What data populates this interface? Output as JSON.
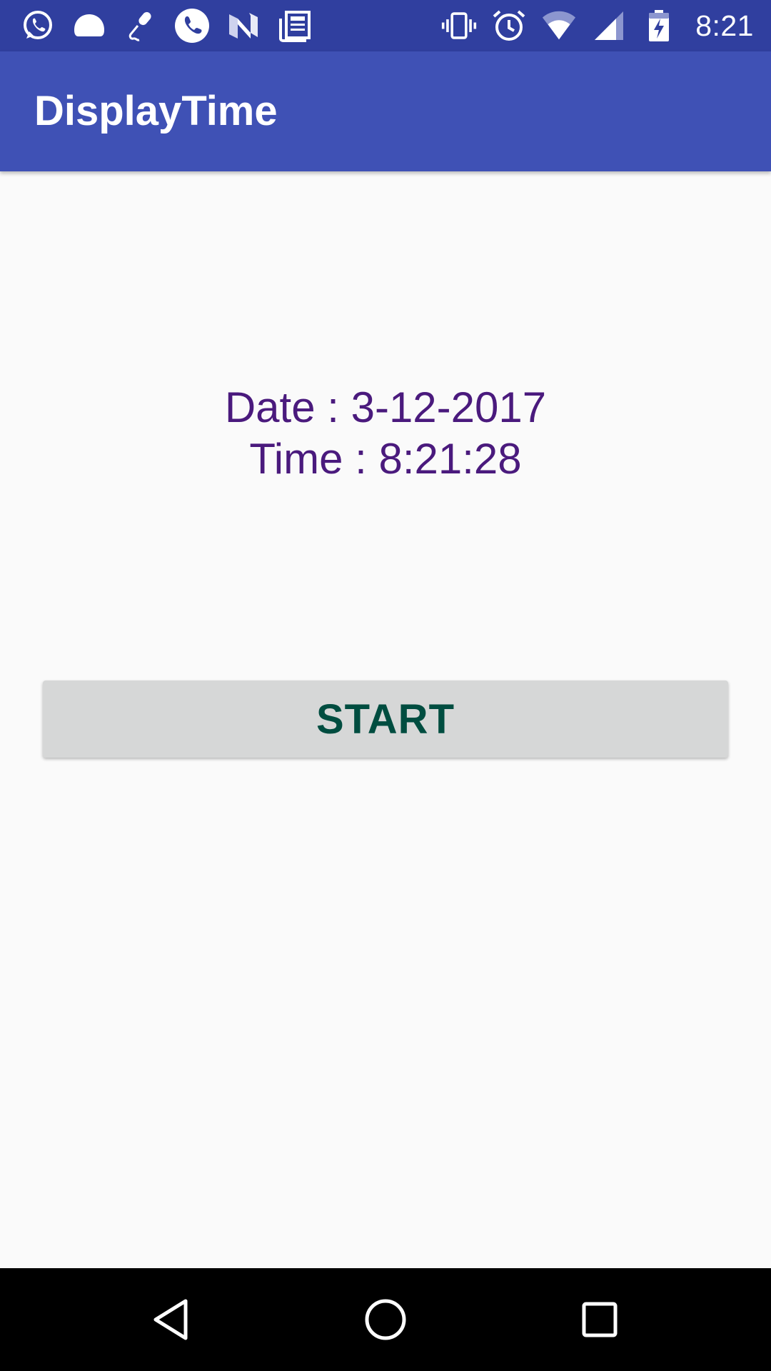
{
  "status_bar": {
    "time": "8:21",
    "left_icons": [
      "whatsapp-icon",
      "chat-bubble-icon",
      "microphone-icon",
      "phone-icon",
      "n-logo-icon",
      "news-icon"
    ],
    "right_icons": [
      "vibrate-icon",
      "alarm-icon",
      "wifi-icon",
      "cell-signal-icon",
      "battery-charging-icon"
    ],
    "background_color": "#303f9f"
  },
  "app_bar": {
    "title": "DisplayTime",
    "background_color": "#3f51b5"
  },
  "main": {
    "date_text": "Date : 3-12-2017",
    "time_text": "Time : 8:21:28",
    "text_color": "#4a1a7d",
    "start_button_label": "START",
    "button_text_color": "#004d40"
  },
  "nav_bar": {
    "buttons": [
      "back-icon",
      "home-icon",
      "recents-icon"
    ]
  }
}
